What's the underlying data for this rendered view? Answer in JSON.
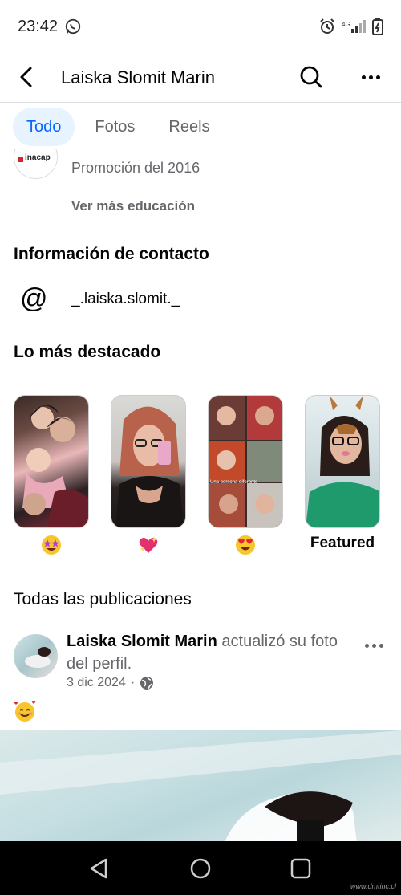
{
  "status_bar": {
    "time": "23:42"
  },
  "header": {
    "title": "Laiska Slomit Marin"
  },
  "tabs": [
    {
      "label": "Todo",
      "active": true
    },
    {
      "label": "Fotos",
      "active": false
    },
    {
      "label": "Reels",
      "active": false
    }
  ],
  "education": {
    "logo_text": "inacap",
    "promotion": "Promoción del 2016",
    "see_more": "Ver más educación"
  },
  "contact": {
    "title": "Información de contacto",
    "icon": "at-sign-icon",
    "value": "_.laiska.slomit._"
  },
  "highlights": {
    "title": "Lo más destacado",
    "items": [
      {
        "label": "",
        "emoji": "star-struck-emoji"
      },
      {
        "label": "",
        "emoji": "sparkling-heart-emoji"
      },
      {
        "label": "",
        "emoji": "heart-eyes-emoji"
      },
      {
        "label": "Featured",
        "emoji": ""
      }
    ],
    "overlay_text": "Una persona diferente"
  },
  "posts": {
    "title": "Todas las publicaciones",
    "items": [
      {
        "author": "Laiska Slomit Marin",
        "action": "actualizó su foto del perfil.",
        "date": "3 dic 2024",
        "visibility": "globe-icon",
        "emoji": "smiling-face-with-hearts-emoji"
      }
    ]
  },
  "watermark": "www.dmtinc.cl",
  "colors": {
    "accent": "#0866ff",
    "tab_active_bg": "#e7f3ff",
    "secondary_text": "#65676b"
  }
}
